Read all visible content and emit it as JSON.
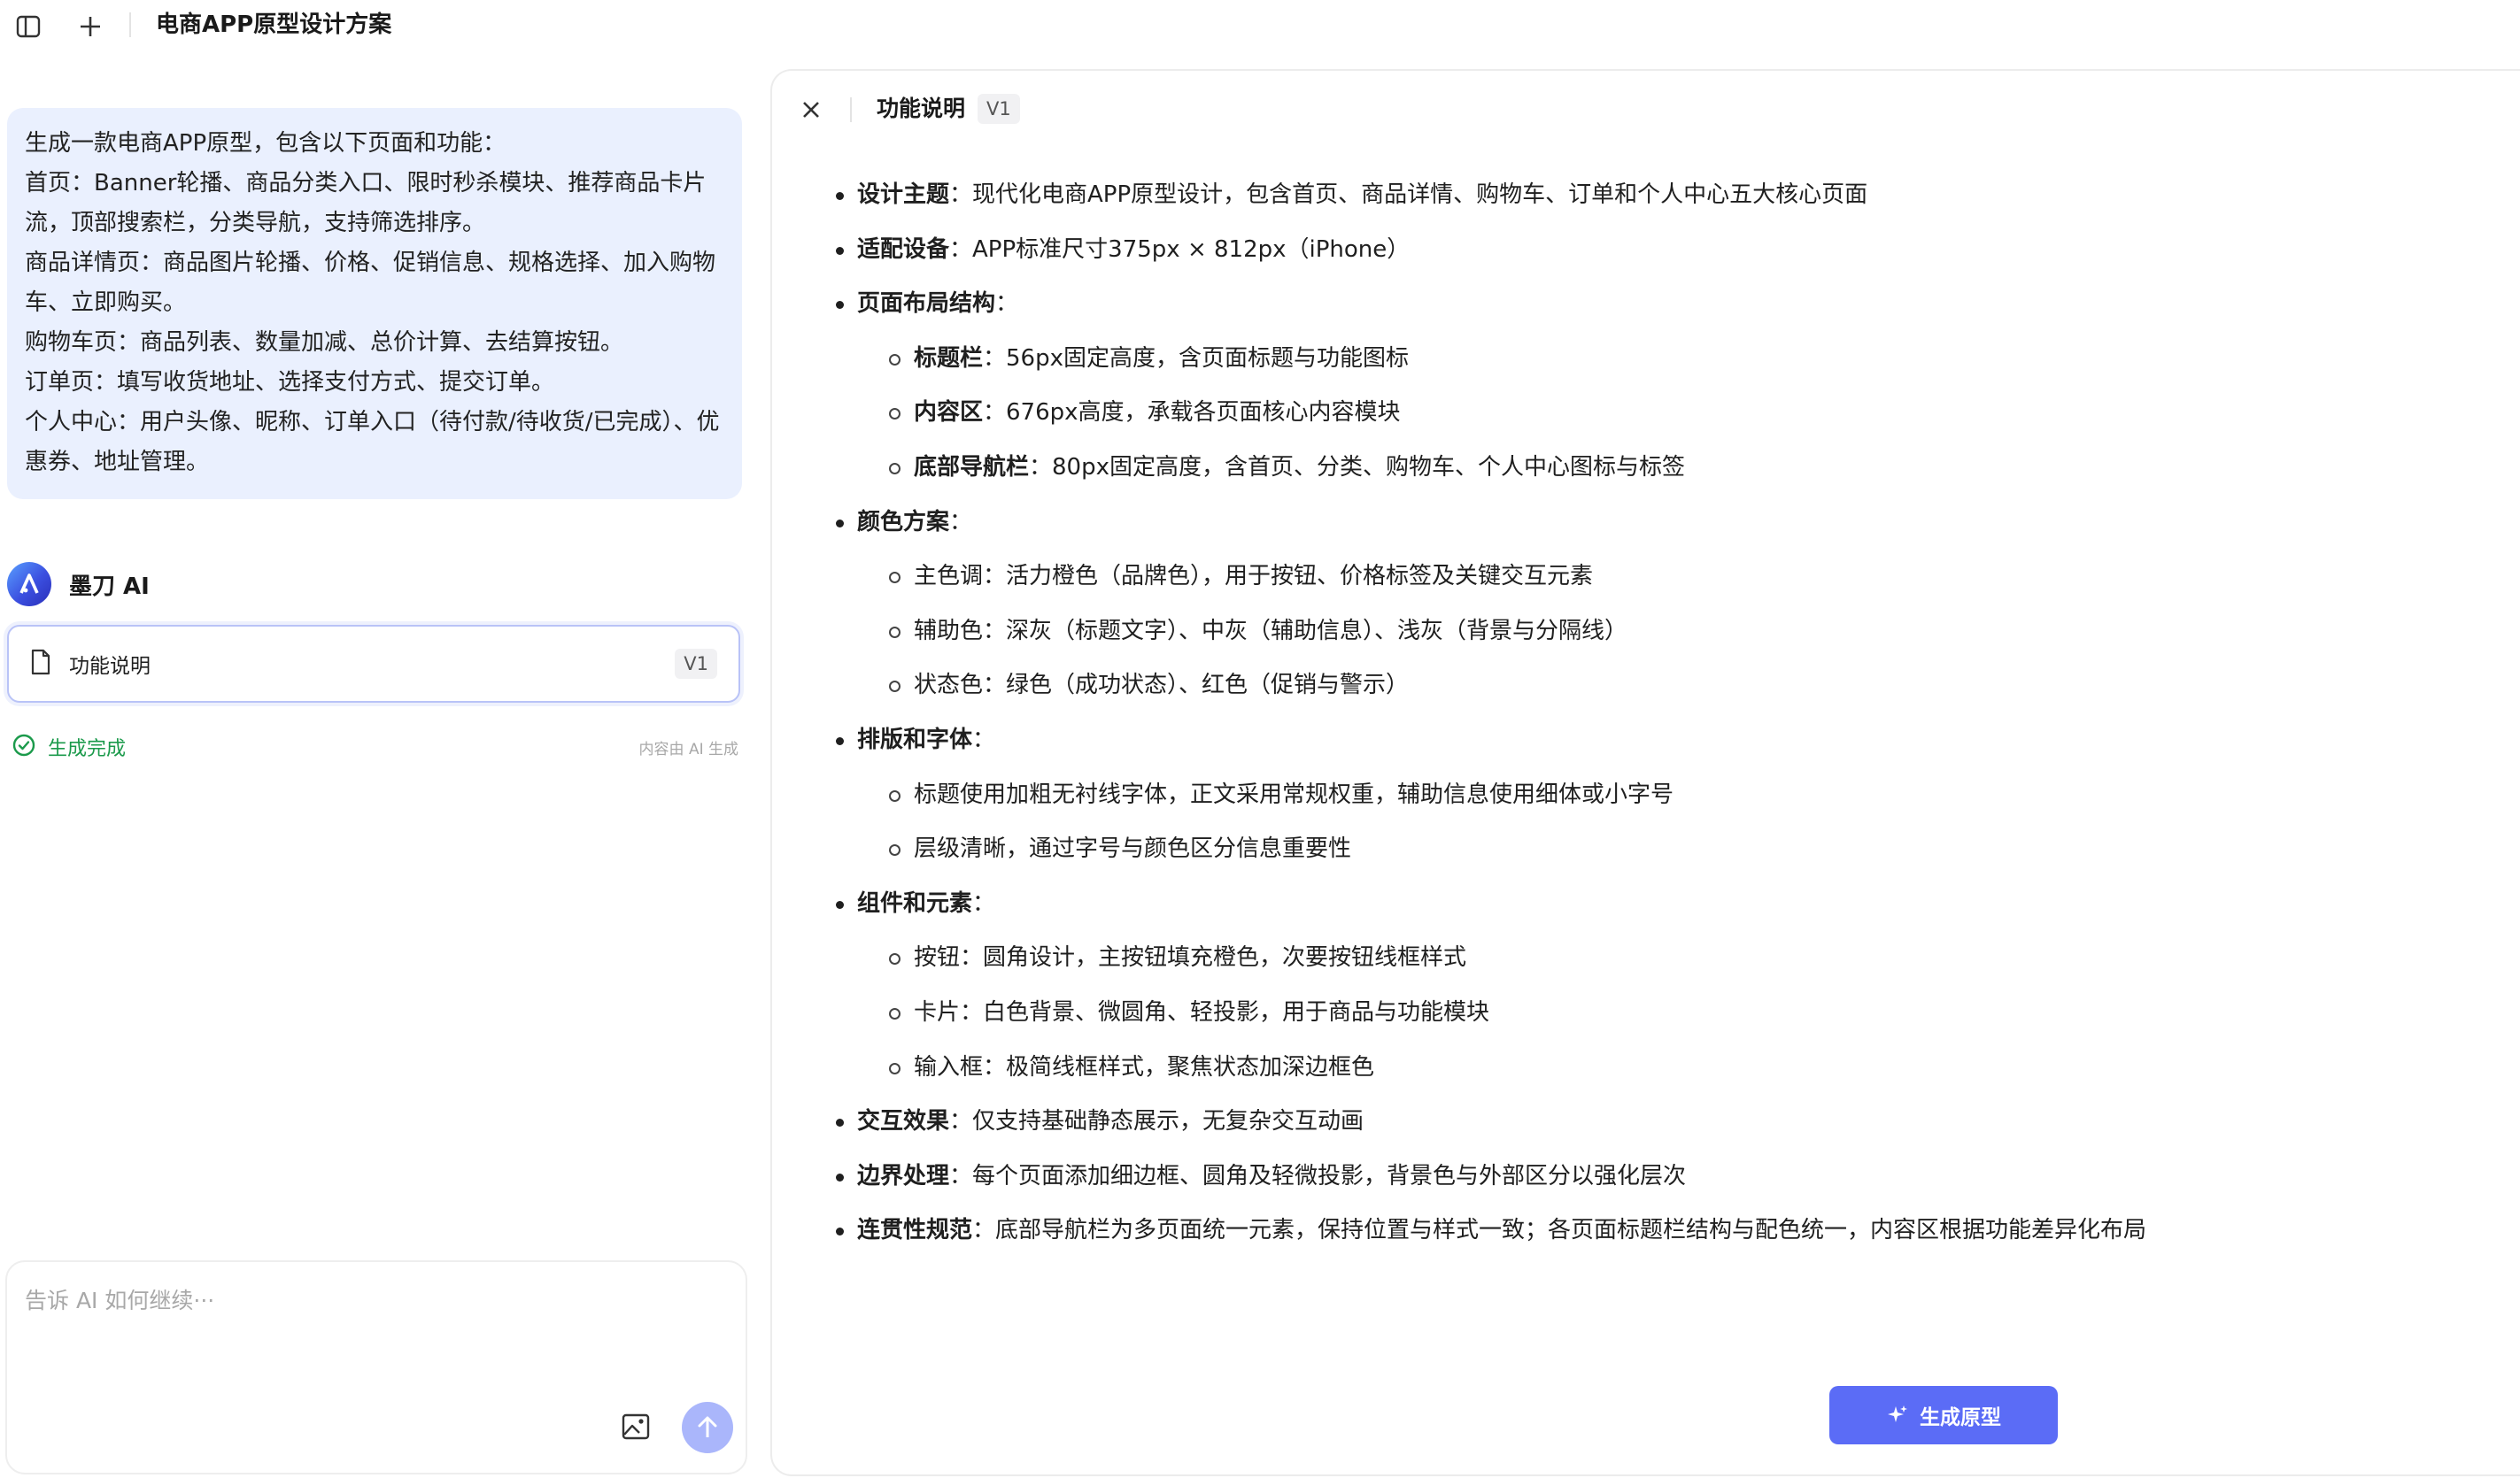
{
  "header": {
    "title": "电商APP原型设计方案"
  },
  "prompt": {
    "lines": [
      "生成一款电商APP原型，包含以下页面和功能：",
      "首页：Banner轮播、商品分类入口、限时秒杀模块、推荐商品卡片",
      "流，顶部搜索栏，分类导航，支持筛选排序。",
      "商品详情页：商品图片轮播、价格、促销信息、规格选择、加入购物",
      "车、立即购买。",
      "购物车页：商品列表、数量加减、总价计算、去结算按钮。",
      "订单页：填写收货地址、选择支付方式、提交订单。",
      "个人中心：用户头像、昵称、订单入口（待付款/待收货/已完成）、优",
      "惠券、地址管理。"
    ]
  },
  "assistant": {
    "name": "墨刀 AI"
  },
  "doc_card": {
    "label": "功能说明",
    "version": "V1"
  },
  "status": {
    "text": "生成完成",
    "note": "内容由 AI 生成"
  },
  "input": {
    "placeholder": "告诉 AI 如何继续···"
  },
  "panel": {
    "title": "功能说明",
    "version": "V1",
    "items": [
      {
        "label": "设计主题",
        "text": "：现代化电商APP原型设计，包含首页、商品详情、购物车、订单和个人中心五大核心页面"
      },
      {
        "label": "适配设备",
        "text": "：APP标准尺寸375px × 812px（iPhone）"
      },
      {
        "label": "页面布局结构",
        "text": "："
      },
      {
        "label": "标题栏",
        "text": "：56px固定高度，含页面标题与功能图标"
      },
      {
        "label": "内容区",
        "text": "：676px高度，承载各页面核心内容模块"
      },
      {
        "label": "底部导航栏",
        "text": "：80px固定高度，含首页、分类、购物车、个人中心图标与标签"
      },
      {
        "label": "颜色方案",
        "text": "："
      },
      {
        "label": "",
        "text": "主色调：活力橙色（品牌色），用于按钮、价格标签及关键交互元素"
      },
      {
        "label": "",
        "text": "辅助色：深灰（标题文字）、中灰（辅助信息）、浅灰（背景与分隔线）"
      },
      {
        "label": "",
        "text": "状态色：绿色（成功状态）、红色（促销与警示）"
      },
      {
        "label": "排版和字体",
        "text": "："
      },
      {
        "label": "",
        "text": "标题使用加粗无衬线字体，正文采用常规权重，辅助信息使用细体或小字号"
      },
      {
        "label": "",
        "text": "层级清晰，通过字号与颜色区分信息重要性"
      },
      {
        "label": "组件和元素",
        "text": "："
      },
      {
        "label": "",
        "text": "按钮：圆角设计，主按钮填充橙色，次要按钮线框样式"
      },
      {
        "label": "",
        "text": "卡片：白色背景、微圆角、轻投影，用于商品与功能模块"
      },
      {
        "label": "",
        "text": "输入框：极简线框样式，聚焦状态加深边框色"
      },
      {
        "label": "交互效果",
        "text": "：仅支持基础静态展示，无复杂交互动画"
      },
      {
        "label": "边界处理",
        "text": "：每个页面添加细边框、圆角及轻微投影，背景色与外部区分以强化层次"
      },
      {
        "label": "连贯性规范",
        "text": "：底部导航栏为多页面统一元素，保持位置与样式一致；各页面标题栏结构与配色统一，内容区根据功能差异化布局"
      }
    ],
    "generate_label": "生成原型"
  },
  "colors": {
    "accent": "#5b6cf6",
    "bubble": "#eaf0fe",
    "success": "#1b9a4b"
  }
}
